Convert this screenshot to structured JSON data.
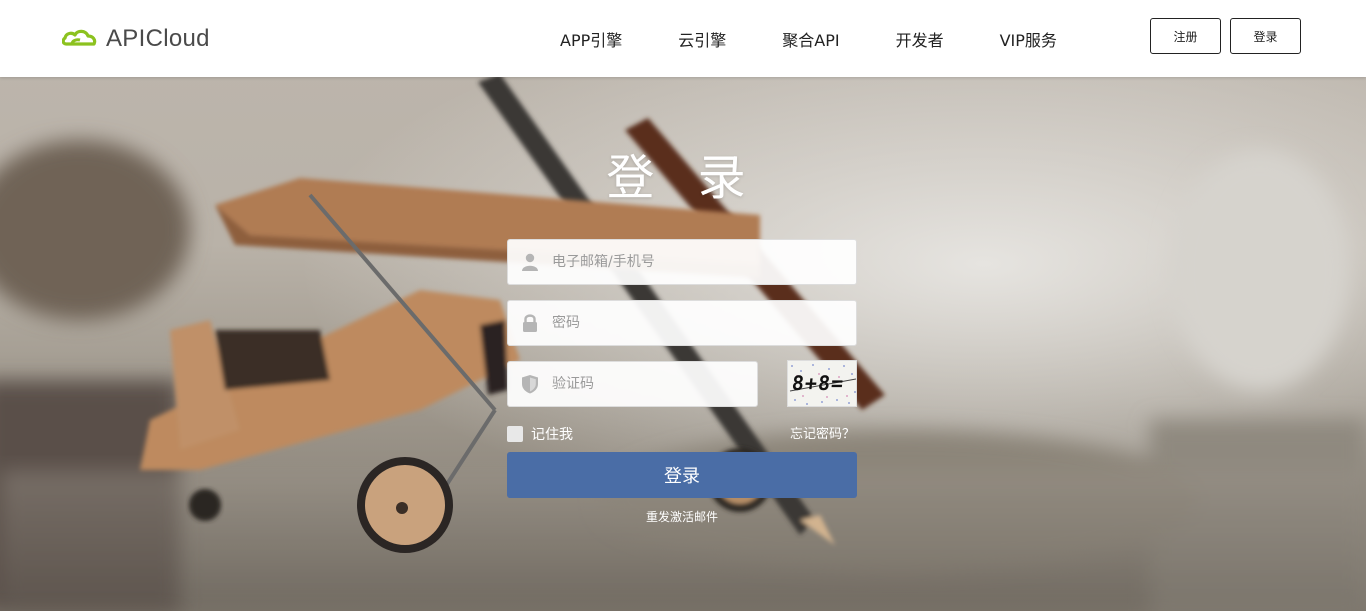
{
  "header": {
    "logo_text": "APICloud",
    "nav": [
      "APP引擎",
      "云引擎",
      "聚合API",
      "开发者",
      "VIP服务"
    ],
    "register_label": "注册",
    "login_label": "登录"
  },
  "login": {
    "title": "登 录",
    "account_placeholder": "电子邮箱/手机号",
    "password_placeholder": "密码",
    "captcha_placeholder": "验证码",
    "captcha_text": "8+8=",
    "remember_label": "记住我",
    "forgot_label": "忘记密码？",
    "submit_label": "登录",
    "resend_label": "重发激活邮件"
  },
  "colors": {
    "brand_green": "#8cc21f",
    "login_button": "#4a6da6"
  }
}
